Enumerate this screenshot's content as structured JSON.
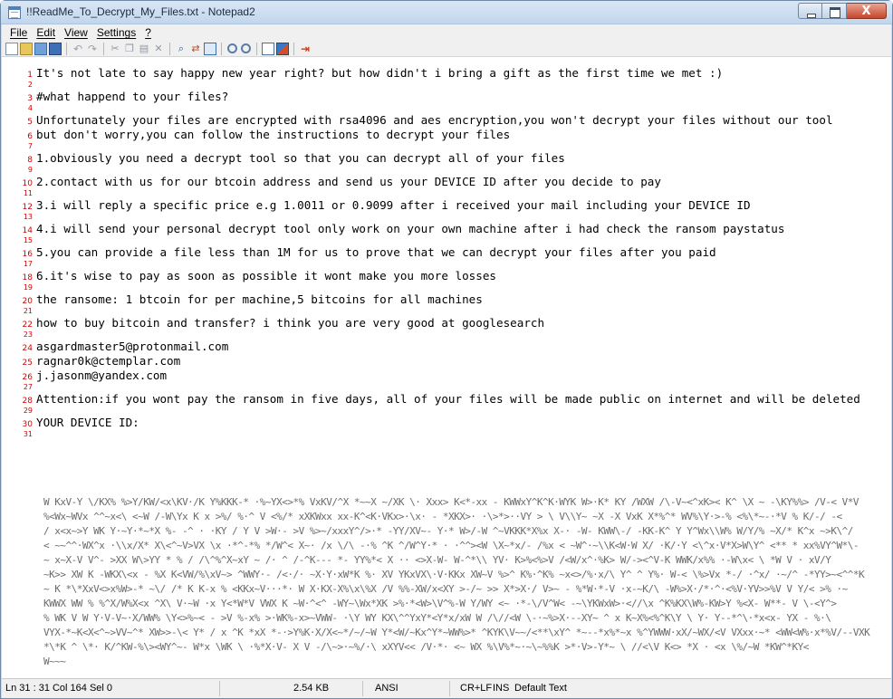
{
  "window": {
    "title": "!!ReadMe_To_Decrypt_My_Files.txt - Notepad2",
    "close_glyph": "X"
  },
  "menu": [
    "File",
    "Edit",
    "View",
    "Settings",
    "?"
  ],
  "toolbar_icons": [
    "new-icon",
    "open-icon",
    "browse-icon",
    "save-icon",
    "undo-icon",
    "redo-icon",
    "cut-icon",
    "copy-icon",
    "paste-icon",
    "clear-icon",
    "find-icon",
    "replace-icon",
    "goto-icon",
    "zoom-in-icon",
    "zoom-out-icon",
    "word-wrap-icon",
    "scheme-icon",
    "exit-icon"
  ],
  "editor": {
    "lines": [
      {
        "n": "1",
        "text": "It's not late to say happy new year right? but how didn't i bring a gift as the first time we met :)"
      },
      {
        "n": "2",
        "text": ""
      },
      {
        "n": "3",
        "text": "#what happend to your files?"
      },
      {
        "n": "4",
        "text": ""
      },
      {
        "n": "5",
        "text": "Unfortunately your files are encrypted with rsa4096 and aes encryption,you won't decrypt your files without our tool"
      },
      {
        "n": "6",
        "text": "but don't worry,you can follow the instructions to decrypt your files"
      },
      {
        "n": "7",
        "text": ""
      },
      {
        "n": "8",
        "text": "1.obviously you need a decrypt tool so that you can decrypt all of your files"
      },
      {
        "n": "9",
        "text": ""
      },
      {
        "n": "10",
        "text": "2.contact with us for our btcoin address and send us your DEVICE ID after you decide to pay"
      },
      {
        "n": "11",
        "text": ""
      },
      {
        "n": "12",
        "text": "3.i will reply a specific price e.g 1.0011 or 0.9099 after i received your mail including your DEVICE ID"
      },
      {
        "n": "13",
        "text": ""
      },
      {
        "n": "14",
        "text": "4.i will send your personal decrypt tool only work on your own machine after i had check the ransom paystatus"
      },
      {
        "n": "15",
        "text": ""
      },
      {
        "n": "16",
        "text": "5.you can provide a file less than 1M for us to prove that we can decrypt your files after you paid"
      },
      {
        "n": "17",
        "text": ""
      },
      {
        "n": "18",
        "text": "6.it's wise to pay as soon as possible it wont make you more losses"
      },
      {
        "n": "19",
        "text": ""
      },
      {
        "n": "20",
        "text": "the ransome: 1 btcoin for per machine,5 bitcoins for all machines"
      },
      {
        "n": "21",
        "text": ""
      },
      {
        "n": "22",
        "text": "how to buy bitcoin and transfer? i think you are very good at googlesearch"
      },
      {
        "n": "23",
        "text": ""
      },
      {
        "n": "24",
        "text": "asgardmaster5@protonmail.com"
      },
      {
        "n": "25",
        "text": "ragnar0k@ctemplar.com"
      },
      {
        "n": "26",
        "text": "j.jasonm@yandex.com"
      },
      {
        "n": "27",
        "text": ""
      },
      {
        "n": "28",
        "text": "Attention:if you wont pay the ransom in five days, all of your files will be made public on internet and will be deleted"
      },
      {
        "n": "29",
        "text": ""
      },
      {
        "n": "30",
        "text": "YOUR DEVICE ID:"
      },
      {
        "n": "31",
        "text": ""
      }
    ]
  },
  "statusbar": {
    "position": "Ln 31 : 31   Col 164   Sel 0",
    "size": "2.54 KB",
    "encoding": "ANSI",
    "eol": "CR+LF",
    "ins": "INS",
    "scheme": "Default Text"
  }
}
